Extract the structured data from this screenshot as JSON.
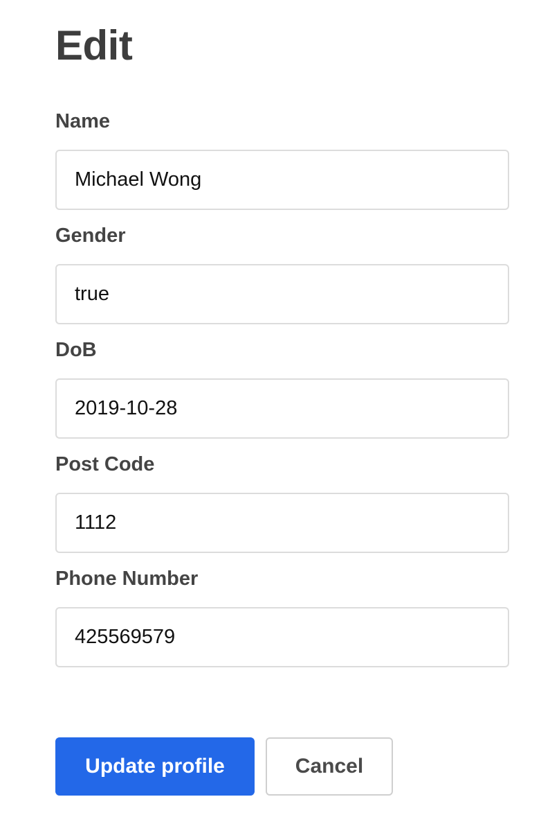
{
  "page": {
    "title": "Edit"
  },
  "form": {
    "fields": [
      {
        "label": "Name",
        "value": "Michael Wong"
      },
      {
        "label": "Gender",
        "value": "true"
      },
      {
        "label": "DoB",
        "value": "2019-10-28"
      },
      {
        "label": "Post Code",
        "value": "1112"
      },
      {
        "label": "Phone Number",
        "value": "425569579"
      }
    ]
  },
  "actions": {
    "update_label": "Update profile",
    "cancel_label": "Cancel"
  },
  "colors": {
    "primary": "#2368e8",
    "text": "#3d3d3d",
    "border": "#dcdcdc"
  }
}
